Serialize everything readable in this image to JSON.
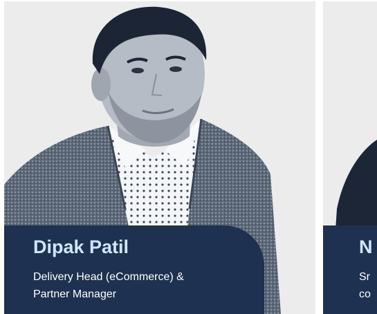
{
  "team_members": [
    {
      "name": "Dipak Patil",
      "role_line1": "Delivery Head (eCommerce) &",
      "role_line2": "Partner Manager"
    },
    {
      "name": "N",
      "role_line1": "Sr",
      "role_line2": "co"
    }
  ],
  "colors": {
    "caption_bg": "#1e3150",
    "name_text": "#cfe7ff",
    "role_text": "#ffffff",
    "photo_bg": "#ececec"
  }
}
